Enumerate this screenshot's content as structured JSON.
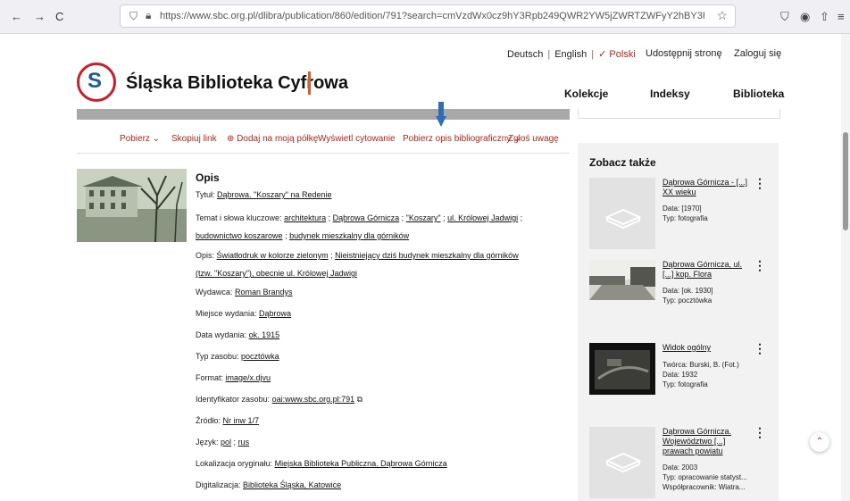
{
  "browser": {
    "back": "←",
    "forward": "→",
    "reload": "C",
    "url": "https://www.sbc.org.pl/dlibra/publication/860/edition/791?search=cmVzdWx0cz9hY3Rpb249QWR2YW5jZWRTZWFyY2hBY3Rpb24mdHlwZT0tMyZwPTAmcWYxPWF2YWlsYWJp",
    "star": "☆",
    "pocket": "⛉",
    "account": "◉",
    "extensions": "⇧",
    "menu": "≡"
  },
  "header": {
    "lang_de": "Deutsch",
    "lang_en": "English",
    "lang_pl": "✓ Polski",
    "share": "Udostępnij stronę",
    "login": "Zaloguj się",
    "logo_letter": "S",
    "site_name": "Śląska Biblioteka Cyfrowa",
    "nav": [
      "Kolekcje",
      "Indeksy",
      "Biblioteka"
    ]
  },
  "toolbar": {
    "download": "Pobierz ⌄",
    "copy_link": "Skopiuj link",
    "add_shelf": "⊕ Dodaj na moją półkę",
    "cite": "Wyświetl cytowanie",
    "bib": "Pobierz opis bibliograficzny ⌄",
    "report": "Zgłoś uwagę"
  },
  "description": {
    "heading": "Opis",
    "title_label": "Tytuł:",
    "title_value": "Dąbrowa. \"Koszary\" na Redenie",
    "subject_label": "Temat i słowa kluczowe:",
    "subjects": [
      "architektura",
      "Dąbrowa Górnicza",
      "\"Koszary\"",
      "ul. Królowej Jadwigi",
      "budownictwo koszarowe",
      "budynek mieszkalny dla górników"
    ],
    "opis_label": "Opis:",
    "opis_values": [
      "Światłodruk w kolorze zielonym",
      "Nieistniejący dziś budynek mieszkalny dla górników (tzw. \"Koszary\"), obecnie ul. Królowej Jadwigi"
    ],
    "publisher_label": "Wydawca:",
    "publisher": "Roman Brandys",
    "place_label": "Miejsce wydania:",
    "place": "Dąbrowa",
    "date_label": "Data wydania:",
    "date": "ok. 1915",
    "type_label": "Typ zasobu:",
    "type": "pocztówka",
    "format_label": "Format:",
    "format": "image/x.djvu",
    "id_label": "Identyfikator zasobu:",
    "id": "oai:www.sbc.org.pl:791",
    "source_label": "Źródło:",
    "source": "Nr inw 1/7",
    "lang_label": "Język:",
    "lang1": "pol",
    "lang2": "rus",
    "location_label": "Lokalizacja oryginału:",
    "location": "Miejska Biblioteka Publiczna. Dąbrowa Górnicza",
    "digit_label": "Digitalizacja:",
    "digit": "Biblioteka Śląska, Katowice"
  },
  "sidebar": {
    "title": "Zobacz także",
    "cards": [
      {
        "title": "Dąbrowa Górnicza - [...] XX wieku",
        "meta": [
          "Data: [1970]",
          "Typ: fotografia"
        ]
      },
      {
        "title": "Dąbrowa Górnicza, ul. [...] kop. Flora",
        "meta": [
          "Data: [ok. 1930]",
          "Typ: pocztówka"
        ]
      },
      {
        "title": "Widok ogólny",
        "meta": [
          "Twórca: Burski, B. (Fot.)",
          "Data: 1932",
          "Typ: fotografia"
        ]
      },
      {
        "title": "Dąbrowa Górnicza. Województwo [...] prawach powiatu",
        "meta": [
          "Data: 2003",
          "Typ: opracowanie statyst...",
          "Współpracownik: Wiatra..."
        ]
      }
    ]
  },
  "scroll_top": "⌃"
}
